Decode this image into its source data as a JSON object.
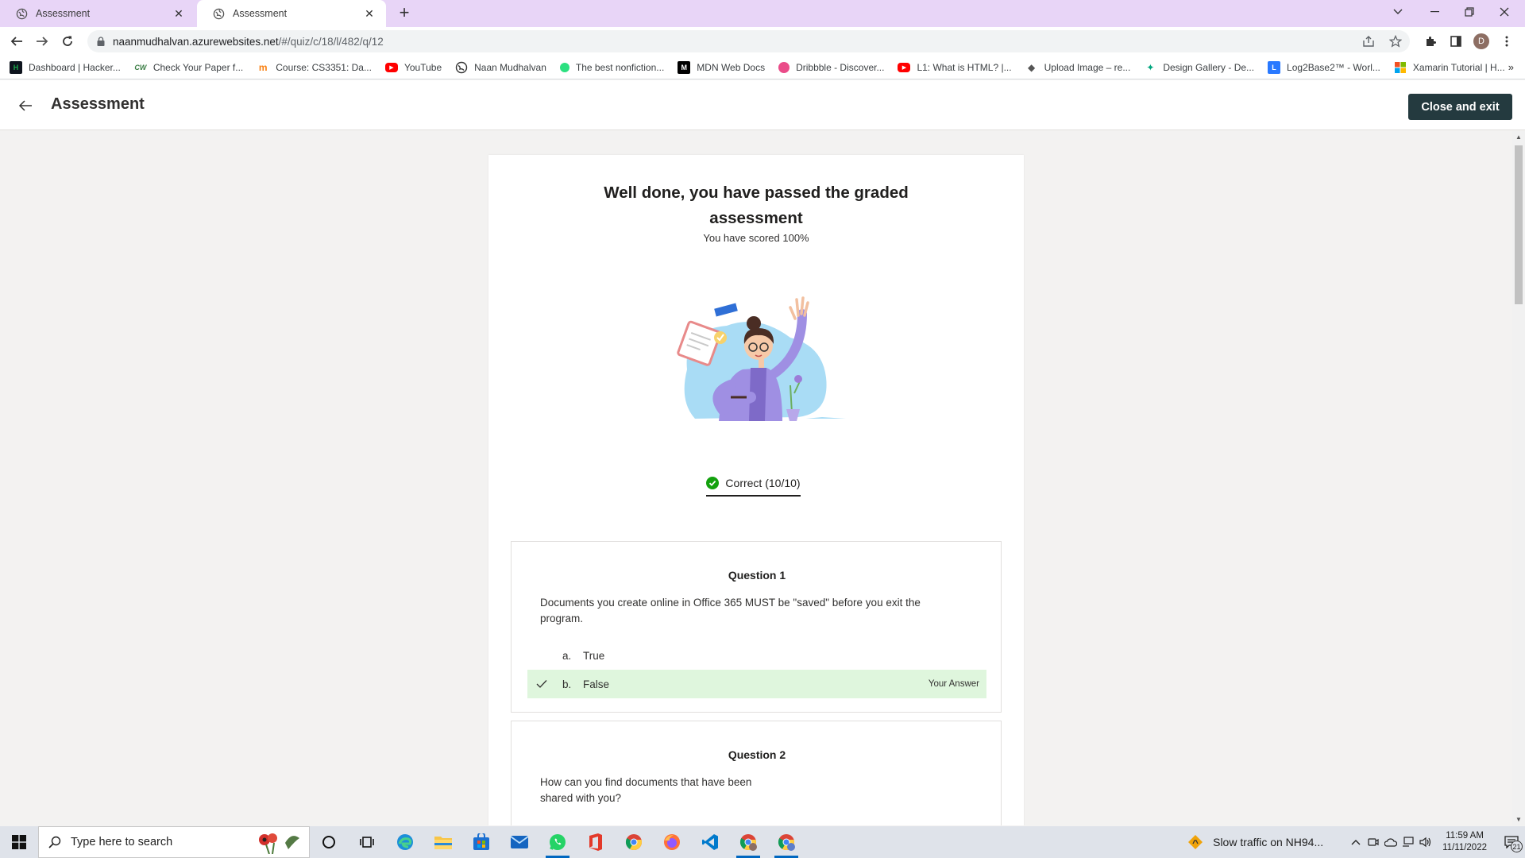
{
  "browser": {
    "tabs": [
      {
        "title": "Assessment",
        "active": false
      },
      {
        "title": "Assessment",
        "active": true
      }
    ],
    "url_host": "naanmudhalvan.azurewebsites.net",
    "url_path": "/#/quiz/c/18/l/482/q/12",
    "profile_initial": "D",
    "bookmarks": [
      {
        "label": "Dashboard | Hacker...",
        "icon": "hackerrank-icon",
        "color": "#1ba94c"
      },
      {
        "label": "Check Your Paper f...",
        "icon": "checker-icon",
        "color": "#3a7d44"
      },
      {
        "label": "Course: CS3351: Da...",
        "icon": "moodle-icon",
        "color": "#f98012"
      },
      {
        "label": "YouTube",
        "icon": "youtube-icon",
        "color": "#ff0000"
      },
      {
        "label": "Naan Mudhalvan",
        "icon": "globe-icon",
        "color": "#333333"
      },
      {
        "label": "The best nonfiction...",
        "icon": "blinkist-icon",
        "color": "#2ce080"
      },
      {
        "label": "MDN Web Docs",
        "icon": "mdn-icon",
        "color": "#000000"
      },
      {
        "label": "Dribbble - Discover...",
        "icon": "dribbble-icon",
        "color": "#ea4c89"
      },
      {
        "label": "L1: What is HTML? |...",
        "icon": "youtube-icon",
        "color": "#ff0000"
      },
      {
        "label": "Upload Image – re...",
        "icon": "upload-icon",
        "color": "#555555"
      },
      {
        "label": "Design Gallery - De...",
        "icon": "sparkle-icon",
        "color": "#00a67e"
      },
      {
        "label": "Log2Base2™ - Worl...",
        "icon": "log2base2-icon",
        "color": "#2979ff"
      },
      {
        "label": "Xamarin Tutorial | H...",
        "icon": "microsoft-icon",
        "color": "#f25022"
      }
    ]
  },
  "header": {
    "title": "Assessment",
    "close_label": "Close and exit",
    "accent": "#243a3f"
  },
  "result": {
    "headline_line1": "Well done, you have passed the graded",
    "headline_line2": "assessment",
    "score_text": "You have scored 100%",
    "tab_label": "Correct (10/10)",
    "success_color": "#13a10e"
  },
  "questions": [
    {
      "title": "Question 1",
      "text": "Documents you create online in Office 365 MUST be \"saved\" before you exit the program.",
      "options": [
        {
          "letter": "a.",
          "text": "True"
        },
        {
          "letter": "b.",
          "text": "False",
          "tag": "Your Answer"
        }
      ],
      "answer_highlight": "#dff6dd"
    },
    {
      "title": "Question 2",
      "text": "How can you find documents that have been shared with you?"
    }
  ],
  "taskbar": {
    "search_placeholder": "Type here to search",
    "traffic_text": "Slow traffic on NH94...",
    "time": "11:59 AM",
    "date": "11/11/2022",
    "notification_count": "21",
    "apps": [
      "cortana-icon",
      "task-view-icon",
      "edge-icon",
      "file-explorer-icon",
      "store-icon",
      "mail-icon",
      "whatsapp-icon",
      "office-icon",
      "chrome-icon",
      "firefox-icon",
      "vscode-icon",
      "chrome-profile-icon",
      "chrome-profile-icon"
    ]
  }
}
